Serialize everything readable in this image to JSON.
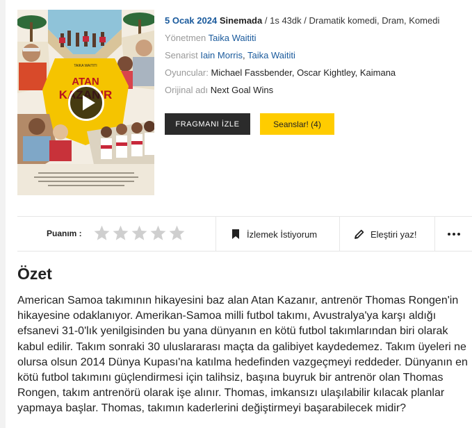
{
  "movie": {
    "release_date": "5 Ocak 2024",
    "release_place": "Sinemada",
    "separator": "/",
    "duration": "1s 43dk",
    "genres": "Dramatik komedi, Dram, Komedi",
    "director_label": "Yönetmen",
    "director": "Taika Waititi",
    "writers_label": "Senarist",
    "writers": [
      "Iain Morris",
      "Taika Waititi"
    ],
    "cast_label": "Oyuncular:",
    "cast": "Michael Fassbender, Oscar Kightley, Kaimana",
    "original_title_label": "Orijinal adı",
    "original_title": "Next Goal Wins"
  },
  "poster": {
    "title_text": "ATAN KAZANIR",
    "director_credit": "TAIKA WAITITI",
    "accent_color": "#f5c400"
  },
  "buttons": {
    "trailer": "FRAGMANI İZLE",
    "sessions": "Seanslar! (4)"
  },
  "actions": {
    "rating_label": "Puanım :",
    "rating_value": 0,
    "rating_max": 5,
    "watchlist": "İzlemek İstiyorum",
    "review": "Eleştiri yaz!"
  },
  "summary": {
    "title": "Özet",
    "text": "American Samoa takımının hikayesini baz alan Atan Kazanır, antrenör Thomas Rongen'in hikayesine odaklanıyor. Amerikan-Samoa milli futbol takımı, Avustralya'ya karşı aldığı efsanevi 31-0'lık yenilgisinden bu yana dünyanın en kötü futbol takımlarından biri olarak kabul edilir. Takım sonraki 30 uluslararası maçta da galibiyet kaydedemez. Takım üyeleri ne olursa olsun  2014 Dünya Kupası'na katılma hedefinden vazgeçmeyi reddeder. Dünyanın en kötü futbol takımını güçlendirmesi için talihsiz, başına buyruk bir antrenör olan Thomas Rongen, takım antrenörü olarak işe alınır. Thomas, imkansızı ulaşılabilir kılacak planlar yapmaya başlar. Thomas, takımın kaderlerini değiştirmeyi başarabilecek midir?"
  },
  "colors": {
    "link": "#1a5a9c",
    "trailer_bg": "#2b2b2b",
    "sessions_bg": "#ffcc00",
    "star_empty": "#cfcfcf"
  }
}
